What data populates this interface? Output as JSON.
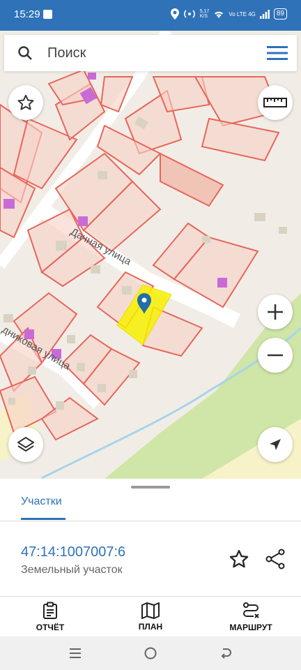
{
  "status_bar": {
    "time": "15:29",
    "net_speed": "5,17\nK/S",
    "network": "Vo LTE 4G",
    "battery": "89"
  },
  "search": {
    "placeholder": "Поиск"
  },
  "map": {
    "street_1": "Дачная улица",
    "street_2": "дниковая улица"
  },
  "sheet": {
    "tab_label": "Участки",
    "parcel_number": "47:14:1007007:6",
    "parcel_type": "Земельный участок"
  },
  "actions": {
    "report": "ОТЧЁТ",
    "plan": "ПЛАН",
    "route": "МАРШРУТ"
  },
  "colors": {
    "accent": "#2f72b8",
    "parcel_border": "#e8655a",
    "selected_parcel": "#f7f000"
  }
}
